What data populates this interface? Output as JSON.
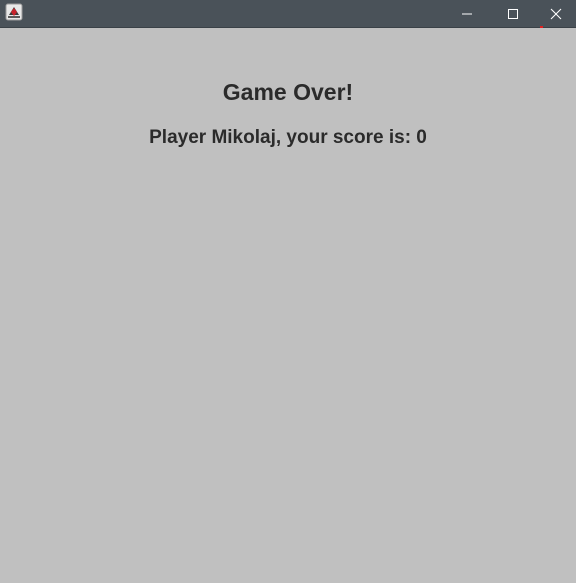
{
  "titlebar": {
    "icon": "java-app-icon",
    "controls": [
      "minimize-icon",
      "maximize-icon",
      "close-icon"
    ]
  },
  "main": {
    "title": "Game Over!",
    "score_text": "Player Mikolaj, your score is: 0"
  },
  "colors": {
    "titlebar_bg": "#4a5259",
    "content_bg": "#c0c0c0",
    "text": "#2b2b2b"
  }
}
